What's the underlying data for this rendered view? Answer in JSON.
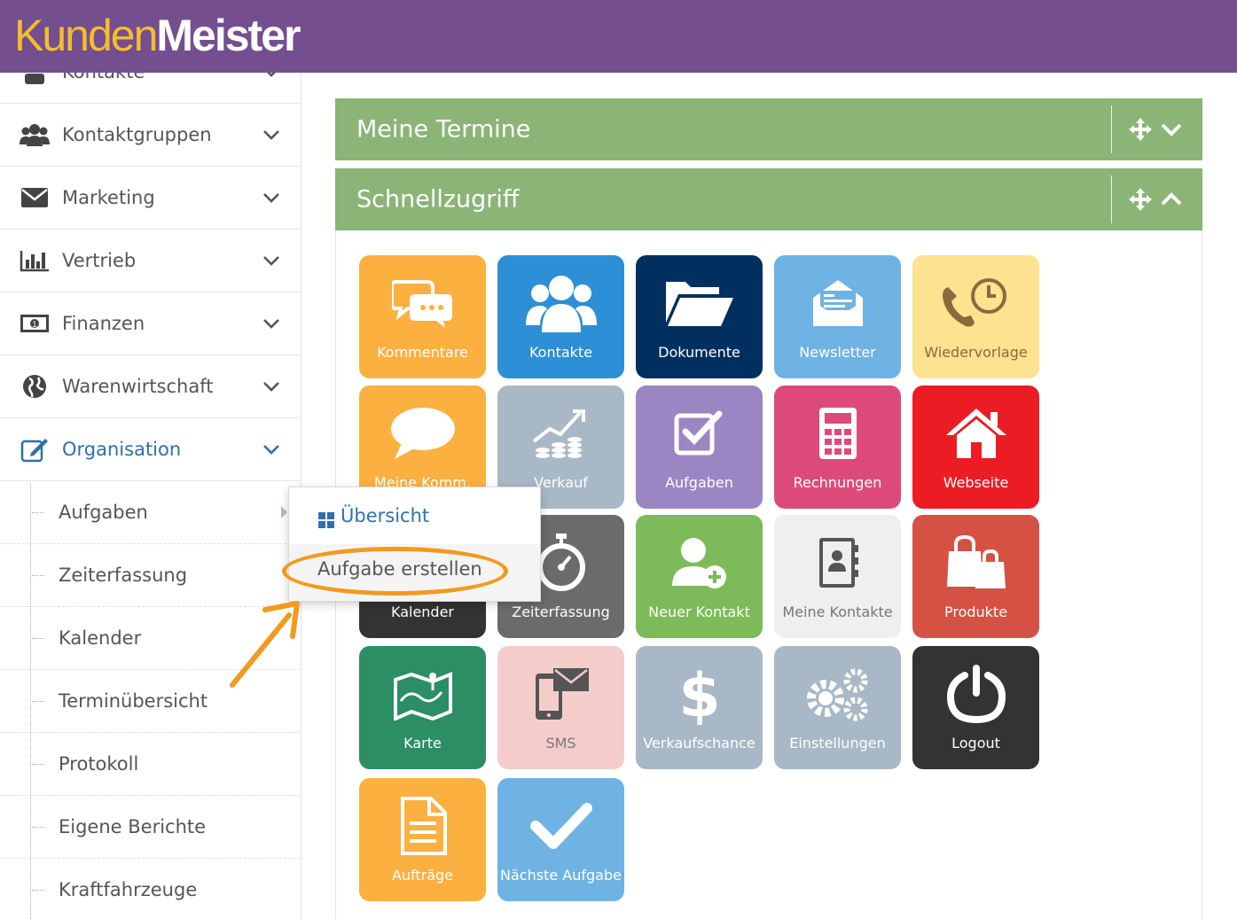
{
  "app": {
    "logo_part1": "Kunden",
    "logo_part2": "Meister",
    "brand_color": "#744e8f",
    "logo_accent_color": "#f2be2e"
  },
  "sidebar": {
    "partial_item": "Kontakte",
    "items": [
      {
        "label": "Kontaktgruppen",
        "icon": "users-icon"
      },
      {
        "label": "Marketing",
        "icon": "envelope-icon"
      },
      {
        "label": "Vertrieb",
        "icon": "bar-chart-icon"
      },
      {
        "label": "Finanzen",
        "icon": "money-icon"
      },
      {
        "label": "Warenwirtschaft",
        "icon": "globe-icon"
      },
      {
        "label": "Organisation",
        "icon": "edit-icon",
        "active": true
      }
    ],
    "subitems": [
      {
        "label": "Aufgaben",
        "has_submenu": true
      },
      {
        "label": "Zeiterfassung"
      },
      {
        "label": "Kalender"
      },
      {
        "label": "Terminübersicht"
      },
      {
        "label": "Protokoll"
      },
      {
        "label": "Eigene Berichte"
      },
      {
        "label": "Kraftfahrzeuge"
      }
    ]
  },
  "panels": {
    "termine_title": "Meine Termine",
    "schnell_title": "Schnellzugriff"
  },
  "tiles": [
    {
      "label": "Kommentare",
      "icon": "comments-icon",
      "color": "#fbb040",
      "text_color": "#ffffff"
    },
    {
      "label": "Kontakte",
      "icon": "users-icon",
      "color": "#2d8fd5",
      "text_color": "#ffffff"
    },
    {
      "label": "Dokumente",
      "icon": "folder-open-icon",
      "color": "#012f5f",
      "text_color": "#ffffff"
    },
    {
      "label": "Newsletter",
      "icon": "newsletter-envelope-icon",
      "color": "#6fb2e4",
      "text_color": "#ffffff"
    },
    {
      "label": "Wiedervorlage",
      "icon": "phone-clock-icon",
      "color": "#fde28f",
      "text_color": "#8b6a3e"
    },
    {
      "label": "Meine Komm.",
      "icon": "speech-bubble-icon",
      "color": "#fbb040",
      "text_color": "#ffffff"
    },
    {
      "label": "Verkauf",
      "icon": "sales-growth-icon",
      "color": "#a8b8c6",
      "text_color": "#ffffff"
    },
    {
      "label": "Aufgaben",
      "icon": "checkbox-icon",
      "color": "#9b85c3",
      "text_color": "#ffffff"
    },
    {
      "label": "Rechnungen",
      "icon": "calculator-icon",
      "color": "#dd4a7a",
      "text_color": "#ffffff"
    },
    {
      "label": "Webseite",
      "icon": "home-icon",
      "color": "#ec1c24",
      "text_color": "#ffffff"
    },
    {
      "label": "Kalender",
      "icon": "calendar-icon",
      "color": "#333333",
      "text_color": "#ffffff"
    },
    {
      "label": "Zeiterfassung",
      "icon": "stopwatch-icon",
      "color": "#6b6b6b",
      "text_color": "#ffffff"
    },
    {
      "label": "Neuer Kontakt",
      "icon": "add-user-icon",
      "color": "#7dba59",
      "text_color": "#ffffff"
    },
    {
      "label": "Meine Kontakte",
      "icon": "address-book-icon",
      "color": "#efefef",
      "text_color": "#777777"
    },
    {
      "label": "Produkte",
      "icon": "shopping-bags-icon",
      "color": "#d55144",
      "text_color": "#ffffff"
    },
    {
      "label": "Karte",
      "icon": "map-icon",
      "color": "#2b8e64",
      "text_color": "#ffffff"
    },
    {
      "label": "SMS",
      "icon": "mobile-sms-icon",
      "color": "#f4cdca",
      "text_color": "#777777"
    },
    {
      "label": "Verkaufschance",
      "icon": "dollar-icon",
      "color": "#a8b8c6",
      "text_color": "#ffffff"
    },
    {
      "label": "Einstellungen",
      "icon": "gears-icon",
      "color": "#a8b8c6",
      "text_color": "#ffffff"
    },
    {
      "label": "Logout",
      "icon": "power-icon",
      "color": "#333333",
      "text_color": "#ffffff"
    },
    {
      "label": "Aufträge",
      "icon": "document-icon",
      "color": "#fbb040",
      "text_color": "#ffffff"
    },
    {
      "label": "Nächste Aufgabe",
      "icon": "checkmark-icon",
      "color": "#6fb2e4",
      "text_color": "#ffffff"
    }
  ],
  "popup": {
    "item1": "Übersicht",
    "item2": "Aufgabe erstellen"
  },
  "annotation": {
    "color": "#f29a1e"
  }
}
